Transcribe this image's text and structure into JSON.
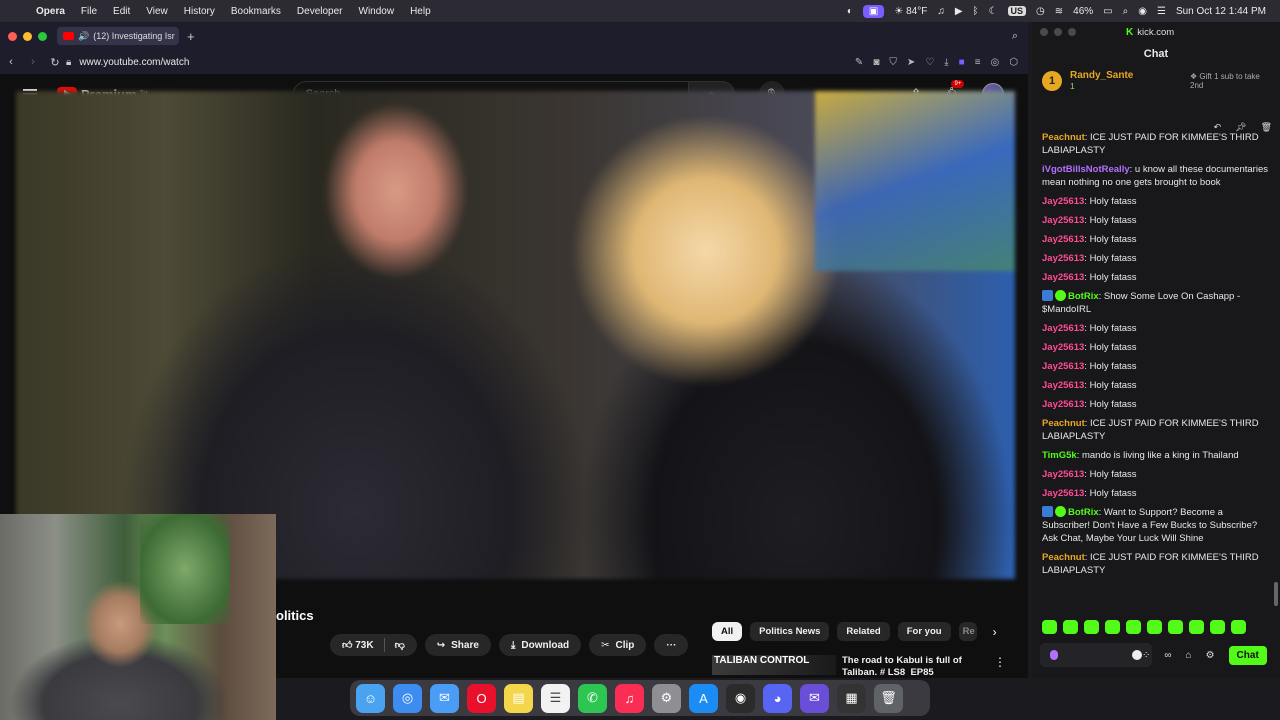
{
  "menubar": {
    "app": "Opera",
    "items": [
      "File",
      "Edit",
      "View",
      "History",
      "Bookmarks",
      "Developer",
      "Window",
      "Help"
    ],
    "weather": "84°F",
    "keyboard": "US",
    "battery": "46%",
    "datetime": "Sun Oct 12  1:44 PM"
  },
  "browser": {
    "tab_count_title": "(12) Investigating Isr",
    "url": "www.youtube.com/watch"
  },
  "youtube": {
    "logo_text": "Premium",
    "logo_sup": "TH",
    "search_placeholder": "Search",
    "notification_badge": "9+",
    "title_fragment": "olitics",
    "likes": "73K",
    "share_label": "Share",
    "download_label": "Download",
    "clip_label": "Clip",
    "more_label": "···",
    "filters": [
      "All",
      "Politics News",
      "Related",
      "For you",
      "Re"
    ],
    "rec_thumb_text": "TALIBAN CONTROL",
    "rec_title": "The road to Kabul is full of Taliban. # LS8_EP85"
  },
  "kick": {
    "site": "kick.com",
    "chat_title": "Chat",
    "gifter": {
      "rank": "1",
      "name": "Randy_Sante",
      "count": "1",
      "cta": "Gift 1 sub to take 2nd"
    },
    "messages": [
      {
        "user": "Peachnut",
        "color": "peach",
        "text": "ICE JUST PAID FOR KIMMEE'S THIRD LABIAPLASTY"
      },
      {
        "user": "iVgotBillsNotReally",
        "color": "purple",
        "text": "u know all these documentaries mean nothing no one gets brought to book"
      },
      {
        "user": "Jay25613",
        "color": "pink",
        "text": "Holy fatass"
      },
      {
        "user": "Jay25613",
        "color": "pink",
        "text": "Holy fatass"
      },
      {
        "user": "Jay25613",
        "color": "pink",
        "text": "Holy fatass"
      },
      {
        "user": "Jay25613",
        "color": "pink",
        "text": "Holy fatass"
      },
      {
        "user": "Jay25613",
        "color": "pink",
        "text": "Holy fatass"
      },
      {
        "user": "BotRix",
        "color": "green",
        "bot": true,
        "text": "Show Some Love On Cashapp - $MandoIRL"
      },
      {
        "user": "Jay25613",
        "color": "pink",
        "text": "Holy fatass"
      },
      {
        "user": "Jay25613",
        "color": "pink",
        "text": "Holy fatass"
      },
      {
        "user": "Jay25613",
        "color": "pink",
        "text": "Holy fatass"
      },
      {
        "user": "Jay25613",
        "color": "pink",
        "text": "Holy fatass"
      },
      {
        "user": "Jay25613",
        "color": "pink",
        "text": "Holy fatass"
      },
      {
        "user": "Peachnut",
        "color": "peach",
        "text": "ICE JUST PAID FOR KIMMEE'S THIRD LABIAPLASTY"
      },
      {
        "user": "TimG5k",
        "color": "green",
        "text": "mando is living like a king in Thailand"
      },
      {
        "user": "Jay25613",
        "color": "pink",
        "text": "Holy fatass"
      },
      {
        "user": "Jay25613",
        "color": "pink",
        "text": "Holy fatass"
      },
      {
        "user": "BotRix",
        "color": "green",
        "bot": true,
        "text": "Want to Support? Become a Subscriber! Don't Have a Few Bucks to Subscribe? Ask Chat, Maybe Your Luck Will Shine"
      },
      {
        "user": "Peachnut",
        "color": "peach",
        "text": "ICE JUST PAID FOR KIMMEE'S THIRD LABIAPLASTY"
      }
    ],
    "chat_button": "Chat"
  },
  "colors": {
    "kick_green": "#53fc18",
    "yt_red": "#ff0000",
    "peach": "#e6a823",
    "purple": "#b270ff",
    "pink": "#ff4c94"
  }
}
